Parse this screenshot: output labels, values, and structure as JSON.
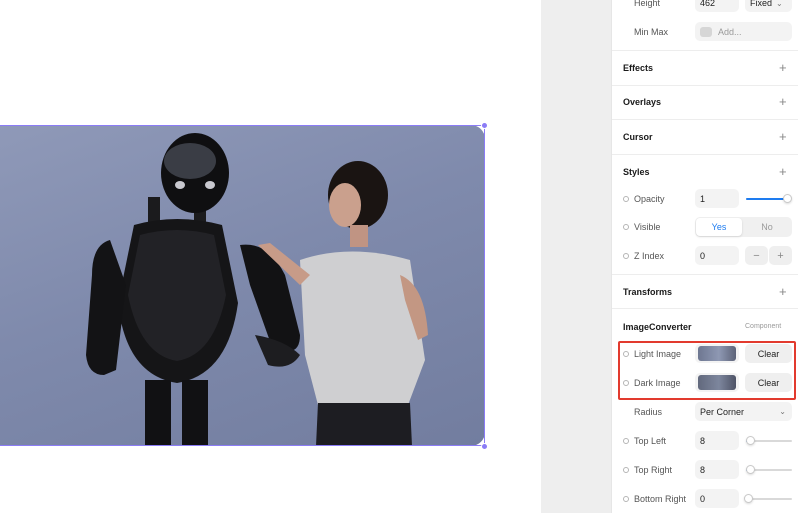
{
  "panel": {
    "height": {
      "label": "Height",
      "value": "462",
      "mode": "Fixed"
    },
    "min_max": {
      "label": "Min Max",
      "placeholder": "Add..."
    },
    "sections": {
      "effects": "Effects",
      "overlays": "Overlays",
      "cursor": "Cursor",
      "styles": "Styles",
      "transforms": "Transforms"
    },
    "styles": {
      "opacity": {
        "label": "Opacity",
        "value": "1",
        "level": 1.0
      },
      "visible": {
        "label": "Visible",
        "yes": "Yes",
        "no": "No",
        "selected": "Yes"
      },
      "z_index": {
        "label": "Z Index",
        "value": "0",
        "minus": "−",
        "plus": "+"
      }
    },
    "component": {
      "name": "ImageConverter",
      "badge": "Component",
      "light_image": {
        "label": "Light Image",
        "clear": "Clear"
      },
      "dark_image": {
        "label": "Dark Image",
        "clear": "Clear"
      },
      "radius": {
        "label": "Radius",
        "value": "Per Corner"
      },
      "top_left": {
        "label": "Top Left",
        "value": "8",
        "level": 0.08
      },
      "top_right": {
        "label": "Top Right",
        "value": "8",
        "level": 0.08
      },
      "bottom_right": {
        "label": "Bottom Right",
        "value": "0",
        "level": 0.0
      }
    }
  },
  "colors": {
    "accent": "#1e7cf0",
    "selection": "#8b7cf6",
    "highlight": "#e23a2e",
    "image_background": "#8390b0"
  },
  "icons": {
    "plus": "+",
    "chevron": "⌄"
  }
}
